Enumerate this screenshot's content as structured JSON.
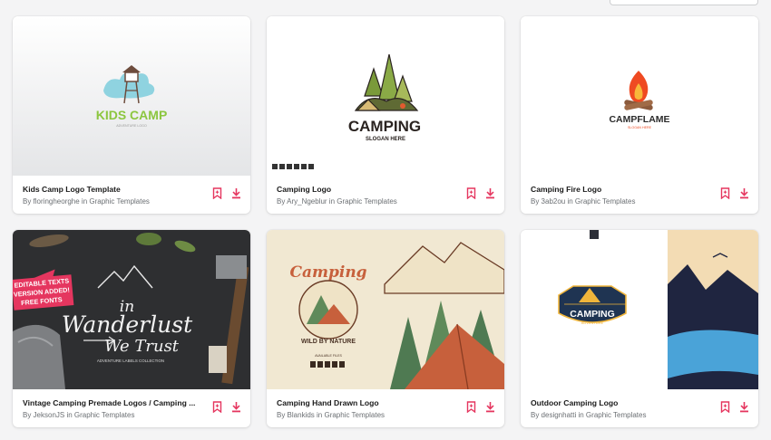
{
  "colors": {
    "accent": "#e5365f",
    "background": "#f4f4f5",
    "card": "#ffffff"
  },
  "icons": {
    "bookmark": "bookmark-icon",
    "download": "download-icon"
  },
  "cards": [
    {
      "title": "Kids Camp Logo Template",
      "byline": "By floringheorghe in Graphic Templates",
      "art": {
        "headline": "KIDS CAMP",
        "subline": "ADVENTURE LOGO"
      }
    },
    {
      "title": "Camping Logo",
      "byline": "By Ary_Ngeblur in Graphic Templates",
      "art": {
        "headline": "CAMPING",
        "subline": "SLOGAN HERE"
      }
    },
    {
      "title": "Camping Fire Logo",
      "byline": "By 3ab2ou in Graphic Templates",
      "art": {
        "headline": "CAMPFLAME",
        "subline": "SLOGAN HERE"
      }
    },
    {
      "title": "Vintage Camping Premade Logos / Camping ...",
      "byline": "By JeksonJS in Graphic Templates",
      "art": {
        "badge1": "EDITABLE TEXTS",
        "badge2": "VERSION ADDED!",
        "badge3": "FREE FONTS",
        "line1": "in",
        "line2": "Wanderlust",
        "line3": "We Trust",
        "caption": "ADVENTURE LABELS COLLECTION"
      }
    },
    {
      "title": "Camping Hand Drawn Logo",
      "byline": "By Blankids in Graphic Templates",
      "art": {
        "headline": "Camping",
        "subline": "WILD BY NATURE",
        "files": "AVAILABLE FILES"
      }
    },
    {
      "title": "Outdoor Camping Logo",
      "byline": "By designhatti in Graphic Templates",
      "art": {
        "headline": "CAMPING",
        "subline": "ADVENTURE"
      }
    }
  ]
}
